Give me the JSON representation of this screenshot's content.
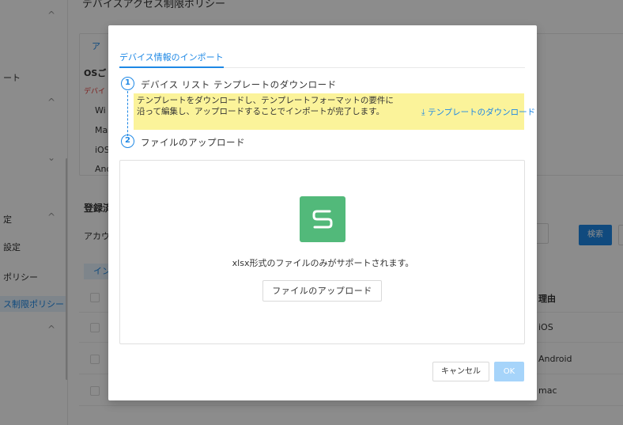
{
  "sidebar": {
    "items": [
      {
        "label": "ート"
      },
      {
        "label": "定"
      },
      {
        "label": "設定"
      },
      {
        "label": "ポリシー"
      },
      {
        "label": "ス制限ポリシー"
      }
    ],
    "chevron_up": "^",
    "chevron_down": "⌄"
  },
  "background": {
    "page_title": "デバイスアクセス制限ポリシー",
    "tab_label": "ア",
    "section_title": "OSご",
    "section_sub": "デバイ",
    "os_list": [
      "Wi",
      "Ma",
      "iOS",
      "And"
    ],
    "registered_title": "登録済",
    "account_label": "アカウ",
    "search_button": "検索",
    "chip_label": "イン",
    "column_header": "理由",
    "rows": [
      "iOS",
      "Android",
      "mac"
    ]
  },
  "modal": {
    "tab_label": "デバイス情報のインポート",
    "step1": {
      "number": "1",
      "title": "デバイス リスト テンプレートのダウンロード"
    },
    "note": {
      "text": "テンプレートをダウンロードし、テンプレートフォーマットの要件に沿って編集し、アップロードすることでインポートが完了します。",
      "link_icon": "⤓",
      "link_label": "テンプレートのダウンロード"
    },
    "step2": {
      "number": "2",
      "title": "ファイルのアップロード"
    },
    "drop_zone": {
      "icon": "spreadsheet-icon",
      "hint": "xlsx形式のファイルのみがサポートされます。",
      "upload_button": "ファイルのアップロード"
    },
    "cancel_button": "キャンセル",
    "ok_button": "OK"
  },
  "colors": {
    "accent": "#1e88e5",
    "note_bg": "#fbf39a",
    "file_icon": "#52b97a",
    "ok_disabled": "#a6d4fa"
  }
}
